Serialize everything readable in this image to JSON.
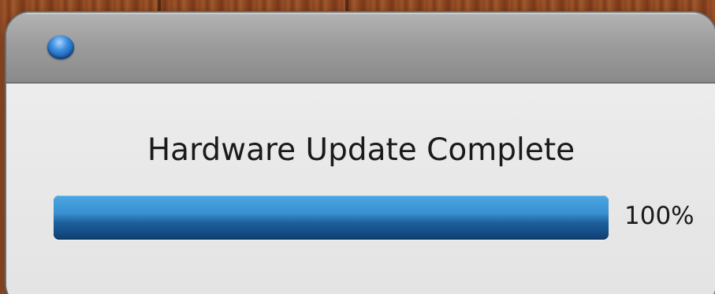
{
  "dialog": {
    "title": "Hardware Update Complete",
    "progress": {
      "value": 100,
      "label": "100%"
    },
    "close_button_color": "#3f8fe0"
  },
  "background": {
    "style": "wood"
  }
}
